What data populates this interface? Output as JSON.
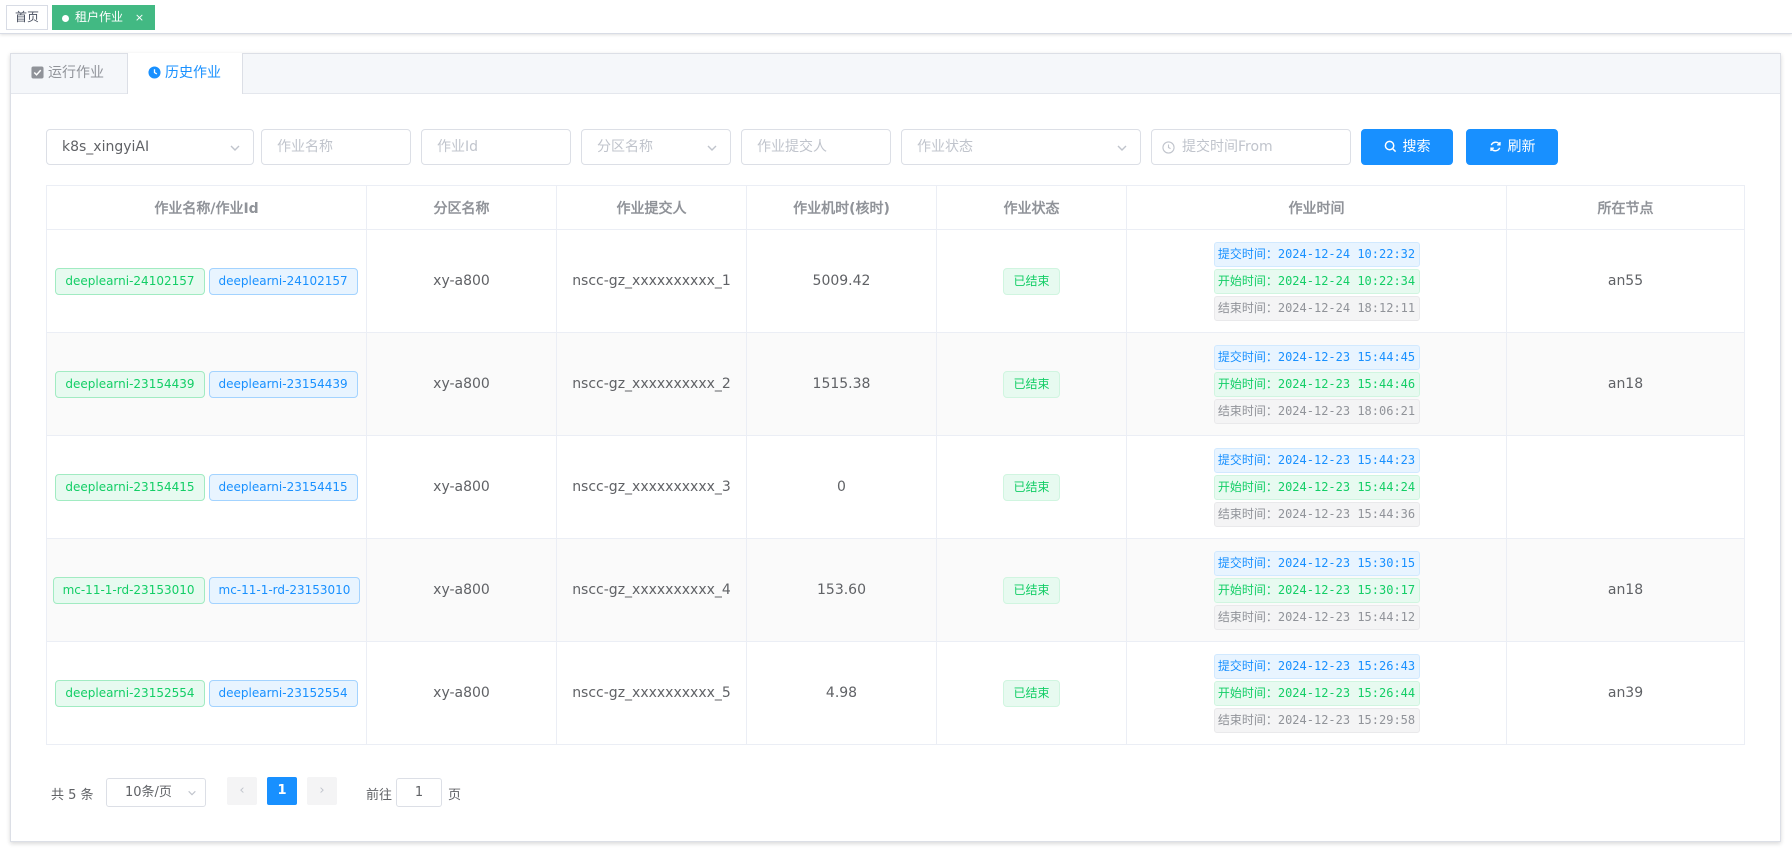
{
  "tags": {
    "home": "首页",
    "active": "租户作业",
    "close": "×"
  },
  "tabs": [
    {
      "label": "运行作业"
    },
    {
      "label": "历史作业"
    }
  ],
  "filters": {
    "cluster": "k8s_xingyiAI",
    "job_name_placeholder": "作业名称",
    "job_id_placeholder": "作业Id",
    "partition_placeholder": "分区名称",
    "submitter_placeholder": "作业提交人",
    "status_placeholder": "作业状态",
    "time_placeholder": "提交时间From",
    "search_label": "搜索",
    "refresh_label": "刷新"
  },
  "table": {
    "headers": [
      "作业名称/作业Id",
      "分区名称",
      "作业提交人",
      "作业机时(核时)",
      "作业状态",
      "作业时间",
      "所在节点"
    ],
    "rows": [
      {
        "name": "deeplearni-24102157",
        "id": "deeplearni-24102157",
        "partition": "xy-a800",
        "submitter": "nscc-gz_xxxxxxxxxx_1",
        "hours": "5009.42",
        "status": "已结束",
        "submit": "2024-12-24 10:22:32",
        "start": "2024-12-24 10:22:34",
        "end": "2024-12-24 18:12:11",
        "node": "an55"
      },
      {
        "name": "deeplearni-23154439",
        "id": "deeplearni-23154439",
        "partition": "xy-a800",
        "submitter": "nscc-gz_xxxxxxxxxx_2",
        "hours": "1515.38",
        "status": "已结束",
        "submit": "2024-12-23 15:44:45",
        "start": "2024-12-23 15:44:46",
        "end": "2024-12-23 18:06:21",
        "node": "an18"
      },
      {
        "name": "deeplearni-23154415",
        "id": "deeplearni-23154415",
        "partition": "xy-a800",
        "submitter": "nscc-gz_xxxxxxxxxx_3",
        "hours": "0",
        "status": "已结束",
        "submit": "2024-12-23 15:44:23",
        "start": "2024-12-23 15:44:24",
        "end": "2024-12-23 15:44:36",
        "node": ""
      },
      {
        "name": "mc-11-1-rd-23153010",
        "id": "mc-11-1-rd-23153010",
        "partition": "xy-a800",
        "submitter": "nscc-gz_xxxxxxxxxx_4",
        "hours": "153.60",
        "status": "已结束",
        "submit": "2024-12-23 15:30:15",
        "start": "2024-12-23 15:30:17",
        "end": "2024-12-23 15:44:12",
        "node": "an18"
      },
      {
        "name": "deeplearni-23152554",
        "id": "deeplearni-23152554",
        "partition": "xy-a800",
        "submitter": "nscc-gz_xxxxxxxxxx_5",
        "hours": "4.98",
        "status": "已结束",
        "submit": "2024-12-23 15:26:43",
        "start": "2024-12-23 15:26:44",
        "end": "2024-12-23 15:29:58",
        "node": "an39"
      }
    ],
    "time_labels": {
      "submit": "提交时间：",
      "start": "开始时间：",
      "end": "结束时间："
    }
  },
  "pagination": {
    "total": "共 5 条",
    "page_size": "10条/页",
    "prev": "‹",
    "next": "›",
    "current": "1",
    "goto_label": "前往",
    "goto_value": "1",
    "page_suffix": "页"
  },
  "colors": {
    "primary": "#1890ff",
    "success": "#13ce66",
    "tag_active": "#42b983"
  }
}
